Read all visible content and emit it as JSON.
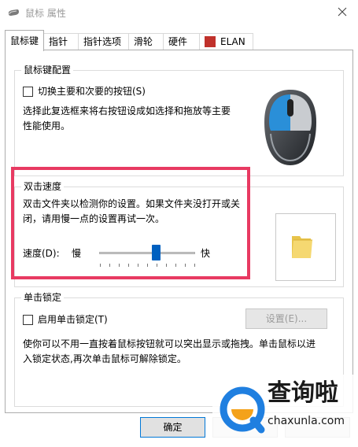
{
  "window": {
    "title": "鼠标 属性"
  },
  "tabs": [
    {
      "label": "鼠标键"
    },
    {
      "label": "指针"
    },
    {
      "label": "指针选项"
    },
    {
      "label": "滑轮"
    },
    {
      "label": "硬件"
    },
    {
      "label": "ELAN"
    }
  ],
  "button_config": {
    "title": "鼠标键配置",
    "switch_label": "切换主要和次要的按钮(S)",
    "switch_checked": false,
    "description_line1": "选择此复选框来将右按钮设成如选择和拖放等主要",
    "description_line2": "性能使用。"
  },
  "double_click": {
    "title": "双击速度",
    "description_line1": "双击文件夹以检测你的设置。如果文件夹没打开或关",
    "description_line2": "闭，请用慢一点的设置再试一次。",
    "speed_label": "速度(D):",
    "slow_label": "慢",
    "fast_label": "快",
    "speed_fraction": 0.6
  },
  "click_lock": {
    "title": "单击锁定",
    "enable_label": "启用单击锁定(T)",
    "enable_checked": false,
    "settings_button": "设置(E)...",
    "description_line1": "使你可以不用一直按着鼠标按钮就可以突出显示或拖拽。单击鼠标以进",
    "description_line2": "入锁定状态,再次单击鼠标可解除锁定。"
  },
  "footer": {
    "ok_label": "确定"
  },
  "watermark": {
    "brand": "查询啦",
    "url": "chaxunla.com"
  },
  "colors": {
    "accent": "#0060c0",
    "highlight_border": "#e83a62",
    "mouse_button": "#2a8fd8"
  }
}
